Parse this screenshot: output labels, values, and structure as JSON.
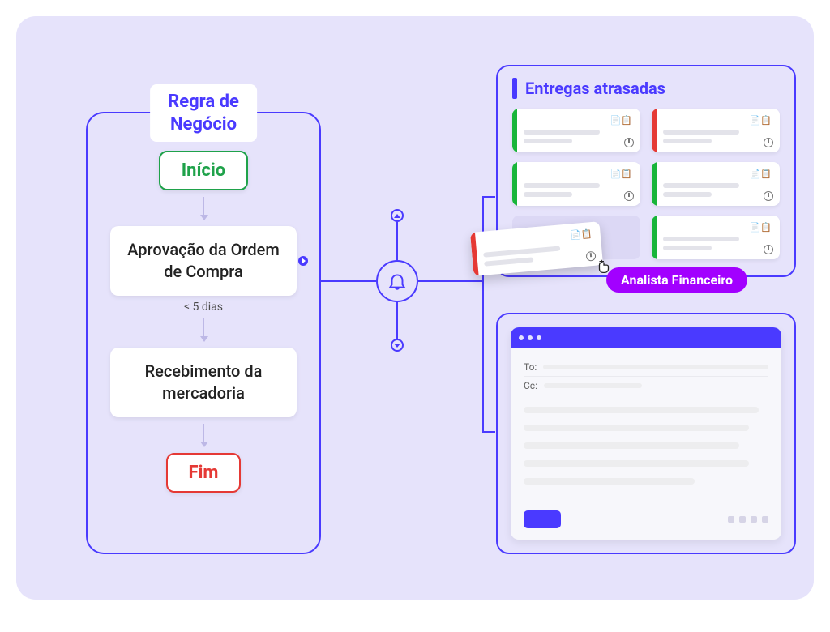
{
  "rule": {
    "title_line1": "Regra de",
    "title_line2": "Negócio",
    "start": "Início",
    "end": "Fim",
    "stage1": "Aprovação da Ordem de Compra",
    "stage2": "Recebimento da mercadoria",
    "sla": "≤ 5 dias"
  },
  "cards_panel": {
    "title": "Entregas atrasadas",
    "items": [
      {
        "status": "green"
      },
      {
        "status": "red"
      },
      {
        "status": "green"
      },
      {
        "status": "green"
      },
      {
        "status": "ghost"
      },
      {
        "status": "green"
      }
    ],
    "dragging": {
      "status": "red"
    },
    "role_label": "Analista Financeiro"
  },
  "mail": {
    "to_label": "To:",
    "cc_label": "Cc:"
  },
  "icons": {
    "bell": "bell-icon",
    "cursor": "cursor-icon"
  }
}
